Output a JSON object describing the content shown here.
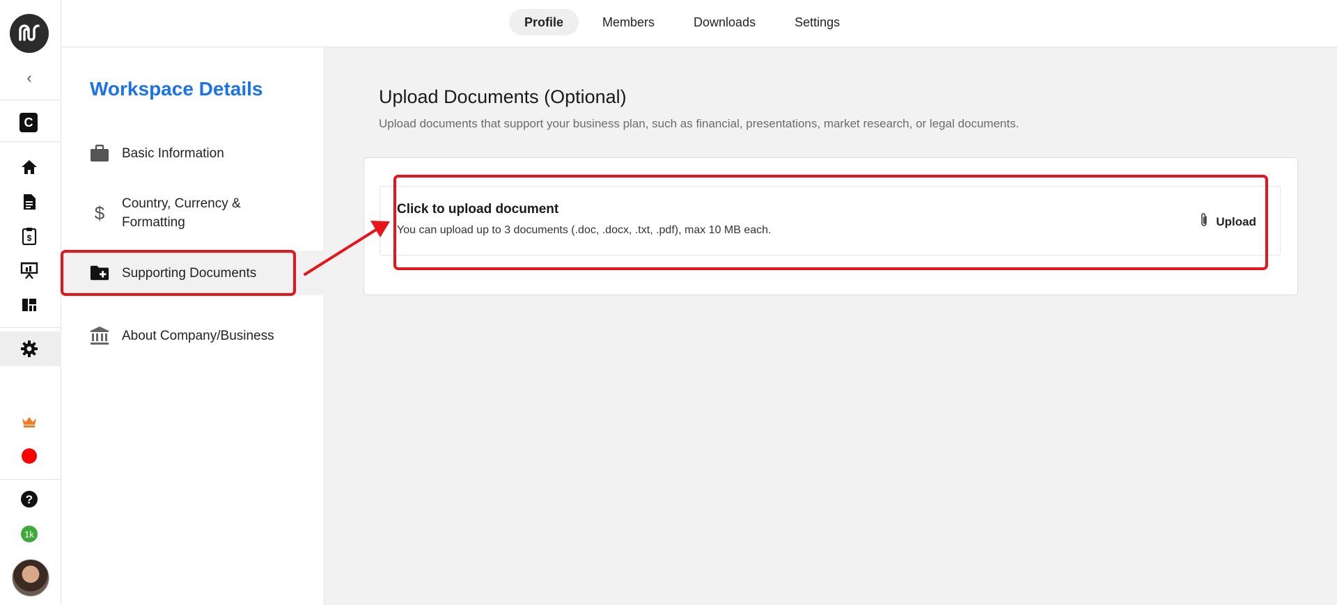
{
  "rail": {
    "workspace_initial": "C",
    "credits_badge": "1k",
    "icons": [
      "app-logo",
      "collapse-chevron",
      "home-icon",
      "document-icon",
      "invoice-clipboard-icon",
      "presentation-icon",
      "dashboard-grid-icon",
      "settings-gear-icon",
      "crown-icon",
      "record-dot-icon",
      "help-icon",
      "credits-badge",
      "user-avatar"
    ],
    "accent_colors": {
      "crown": "#f07b2a",
      "record": "#ff0000",
      "credits": "#3fa83a"
    }
  },
  "topbar": {
    "tabs": [
      {
        "label": "Profile",
        "active": true
      },
      {
        "label": "Members",
        "active": false
      },
      {
        "label": "Downloads",
        "active": false
      },
      {
        "label": "Settings",
        "active": false
      }
    ]
  },
  "sidebar": {
    "title": "Workspace Details",
    "items": [
      {
        "label": "Basic Information",
        "icon": "briefcase-icon",
        "active": false
      },
      {
        "label": "Country, Currency & Formatting",
        "icon": "dollar-icon",
        "active": false
      },
      {
        "label": "Supporting Documents",
        "icon": "folder-add-icon",
        "active": true
      },
      {
        "label": "About Company/Business",
        "icon": "bank-icon",
        "active": false
      }
    ]
  },
  "main": {
    "heading": "Upload Documents (Optional)",
    "description": "Upload documents that support your business plan, such as financial, presentations, market research, or legal documents.",
    "upload": {
      "title": "Click to upload document",
      "subtitle": "You can upload up to 3 documents (.doc, .docx, .txt, .pdf), max 10 MB each.",
      "button_label": "Upload",
      "button_icon": "paperclip-icon"
    }
  },
  "annotation": {
    "highlight_color": "#e8141c"
  }
}
